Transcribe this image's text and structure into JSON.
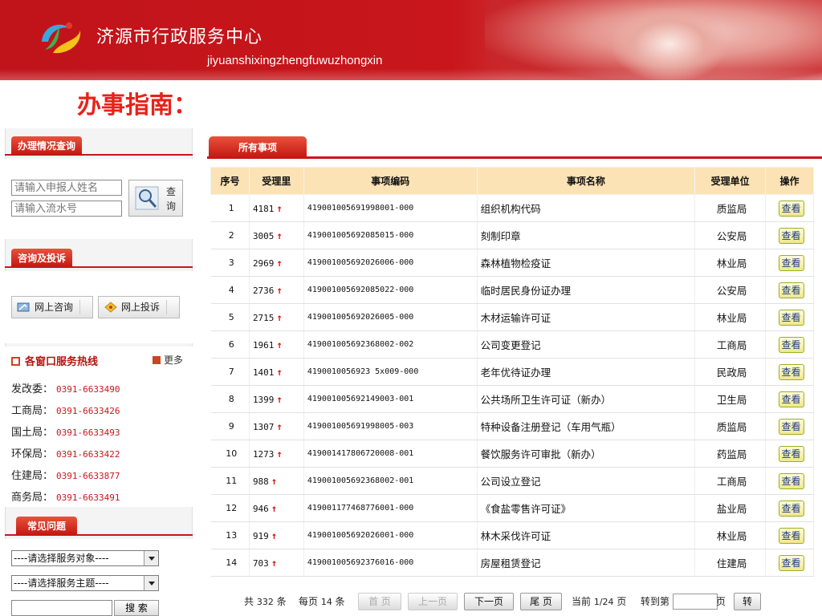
{
  "header": {
    "title": "济源市行政服务中心",
    "pinyin": "jiyuanshixingzhengfuwuzhongxin"
  },
  "page_heading": "办事指南：",
  "sidebar": {
    "query": {
      "section_title": "办理情况查询",
      "name_placeholder": "请输入申报人姓名",
      "serial_placeholder": "请输入流水号",
      "button_label": "查询"
    },
    "consult": {
      "section_title": "咨询及投诉",
      "online_consult": "网上咨询",
      "online_complaint": "网上投诉"
    },
    "hotline": {
      "title": "各窗口服务热线",
      "more": "更多",
      "items": [
        {
          "dept": "发改委：",
          "phone": "0391-6633490"
        },
        {
          "dept": "工商局：",
          "phone": "0391-6633426"
        },
        {
          "dept": "国土局：",
          "phone": "0391-6633493"
        },
        {
          "dept": "环保局：",
          "phone": "0391-6633422"
        },
        {
          "dept": "住建局：",
          "phone": "0391-6633877"
        },
        {
          "dept": "商务局：",
          "phone": "0391-6633491"
        }
      ]
    },
    "faq": {
      "section_title": "常见问题",
      "select_target": "----请选择服务对象----",
      "select_topic": "----请选择服务主题----",
      "search_label": "搜 索"
    }
  },
  "main": {
    "tab_label": "所有事项",
    "columns": [
      "序号",
      "受理里",
      "事项编码",
      "事项名称",
      "受理单位",
      "操作"
    ],
    "view_label": "查看",
    "rows": [
      {
        "idx": "1",
        "count": "4181",
        "code": "419001005691998001-000",
        "name": "组织机构代码",
        "dept": "质监局"
      },
      {
        "idx": "2",
        "count": "3005",
        "code": "419001005692085015-000",
        "name": "刻制印章",
        "dept": "公安局"
      },
      {
        "idx": "3",
        "count": "2969",
        "code": "419001005692026006-000",
        "name": "森林植物检疫证",
        "dept": "林业局"
      },
      {
        "idx": "4",
        "count": "2736",
        "code": "419001005692085022-000",
        "name": "临时居民身份证办理",
        "dept": "公安局"
      },
      {
        "idx": "5",
        "count": "2715",
        "code": "419001005692026005-000",
        "name": "木材运输许可证",
        "dept": "林业局"
      },
      {
        "idx": "6",
        "count": "1961",
        "code": "419001005692368002-002",
        "name": "公司变更登记",
        "dept": "工商局"
      },
      {
        "idx": "7",
        "count": "1401",
        "code": "4190010056923 5x009-000",
        "name": "老年优待证办理",
        "dept": "民政局"
      },
      {
        "idx": "8",
        "count": "1399",
        "code": "419001005692149003-001",
        "name": "公共场所卫生许可证（新办）",
        "dept": "卫生局"
      },
      {
        "idx": "9",
        "count": "1307",
        "code": "419001005691998005-003",
        "name": "特种设备注册登记（车用气瓶）",
        "dept": "质监局"
      },
      {
        "idx": "10",
        "count": "1273",
        "code": "419001417806720008-001",
        "name": "餐饮服务许可审批（新办）",
        "dept": "药监局"
      },
      {
        "idx": "11",
        "count": "988",
        "code": "419001005692368002-001",
        "name": "公司设立登记",
        "dept": "工商局"
      },
      {
        "idx": "12",
        "count": "946",
        "code": "419001177468776001-000",
        "name": "《食盐零售许可证》",
        "dept": "盐业局"
      },
      {
        "idx": "13",
        "count": "919",
        "code": "419001005692026001-000",
        "name": "林木采伐许可证",
        "dept": "林业局"
      },
      {
        "idx": "14",
        "count": "703",
        "code": "419001005692376016-000",
        "name": "房屋租赁登记",
        "dept": "住建局"
      }
    ]
  },
  "pager": {
    "total_prefix": "共",
    "total": "332",
    "total_suffix": "条",
    "per_page_prefix": "每页",
    "per_page": "14",
    "per_page_suffix": "条",
    "first": "首 页",
    "prev": "上一页",
    "next": "下一页",
    "last": "尾 页",
    "current_prefix": "当前",
    "current": "1/24",
    "current_suffix": "页",
    "goto_prefix": "转到第",
    "goto_suffix": "页",
    "go": "转"
  },
  "colors": {
    "brand_red": "#c8161c",
    "header_tan": "#fbe3b6",
    "view_button": "#f0e88c"
  }
}
